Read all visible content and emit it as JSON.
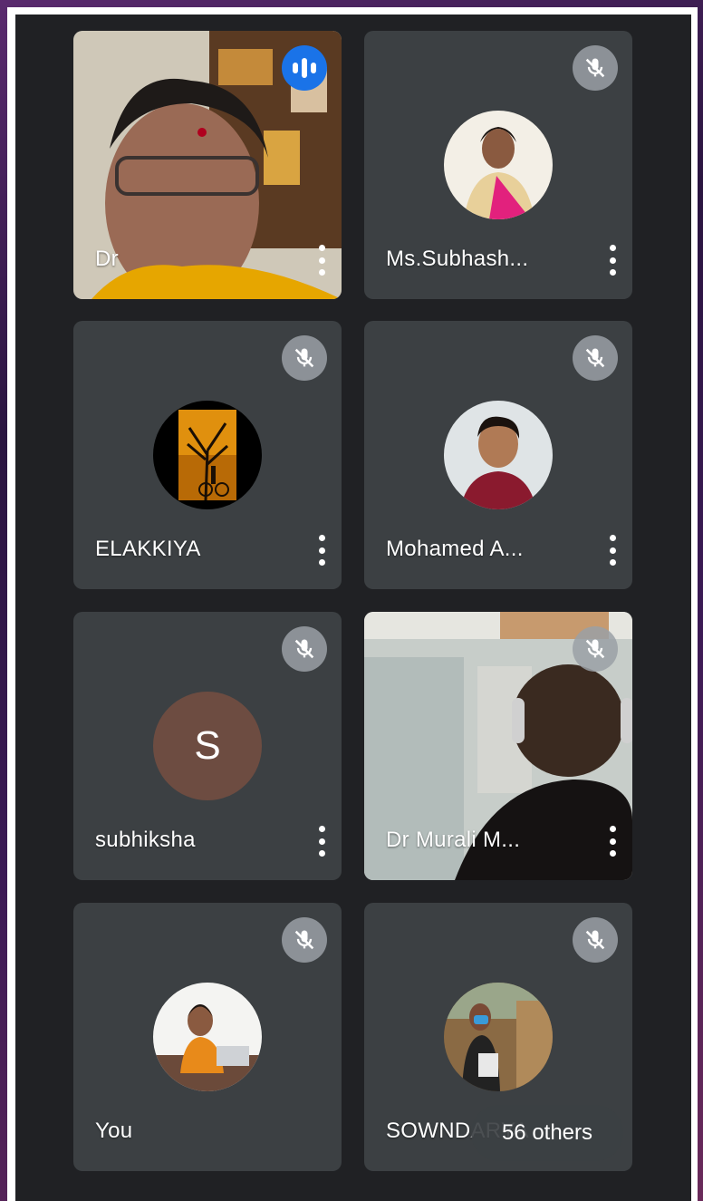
{
  "participants": [
    {
      "name": "Dr",
      "mic": "speaking",
      "view": "video"
    },
    {
      "name": "Ms.Subhash...",
      "mic": "muted",
      "view": "avatar-photo"
    },
    {
      "name": "ELAKKIYA",
      "mic": "muted",
      "view": "avatar-photo"
    },
    {
      "name": "Mohamed A...",
      "mic": "muted",
      "view": "avatar-photo"
    },
    {
      "name": "subhiksha",
      "mic": "muted",
      "view": "avatar-letter",
      "initial": "S",
      "avatar_color": "#6d4c41"
    },
    {
      "name": "Dr Murali M...",
      "mic": "muted",
      "view": "video"
    },
    {
      "name": "You",
      "mic": "muted",
      "view": "avatar-photo"
    },
    {
      "name": "SOWNDARYA",
      "mic": "muted",
      "view": "avatar-photo"
    }
  ],
  "others_chip": {
    "label": "56 others"
  },
  "icons": {
    "muted": "mic-off-icon",
    "speaking": "speaking-icon",
    "more": "more-vert-icon"
  },
  "colors": {
    "tile": "#3c4043",
    "background": "#202124",
    "speaking": "#1a73e8"
  }
}
